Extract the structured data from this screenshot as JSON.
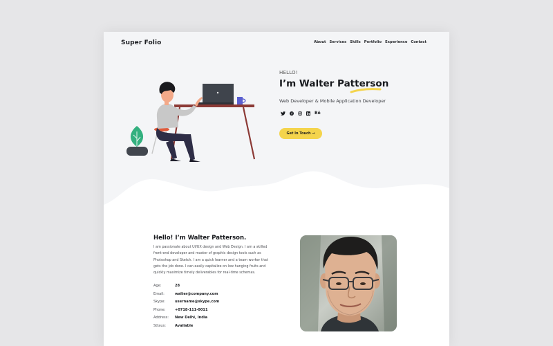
{
  "nav": {
    "brand": "Super Folio",
    "items": [
      {
        "label": "About"
      },
      {
        "label": "Services"
      },
      {
        "label": "Skills"
      },
      {
        "label": "Portfolio"
      },
      {
        "label": "Experience"
      },
      {
        "label": "Contact"
      }
    ]
  },
  "hero": {
    "greeting": "HELLO!",
    "name": "I’m Walter Patterson",
    "role": "Web Developer & Mobile Application Developer",
    "socials": [
      {
        "icon": "twitter-icon"
      },
      {
        "icon": "facebook-icon"
      },
      {
        "icon": "instagram-icon"
      },
      {
        "icon": "linkedin-icon"
      },
      {
        "icon": "behance-icon",
        "label": "Bē"
      }
    ],
    "cta_label": "Get In Touch →"
  },
  "about": {
    "title": "Hello! I’m Walter Patterson.",
    "bio": "I am passionate about UI/UX design and Web Design. I am a skilled front-end developer and master of graphic design tools such as Photoshop and Sketch. I am a quick learner and a team worker that gets the job done. I can easily capitalize on low hanging fruits and quickly maximize timely deliverables for real-time schemas.",
    "details": [
      {
        "label": "Age:",
        "value": "28"
      },
      {
        "label": "Email:",
        "value": "walter@company.com"
      },
      {
        "label": "Skype:",
        "value": "username@skype.com"
      },
      {
        "label": "Phone:",
        "value": "+0718-111-0011"
      },
      {
        "label": "Address:",
        "value": "New Delhi, India"
      },
      {
        "label": "Sttaus:",
        "value": "Available"
      }
    ]
  },
  "colors": {
    "accent": "#f4d44c",
    "hero_bg": "#f4f5f7",
    "page_bg": "#e6e6e8",
    "text_dark": "#17191d"
  }
}
